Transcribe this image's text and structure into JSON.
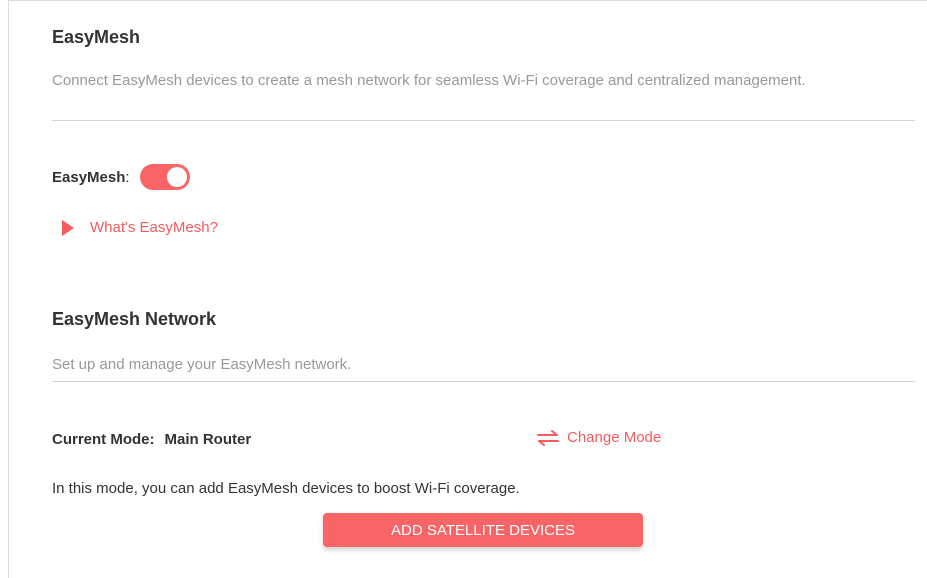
{
  "easymesh": {
    "title": "EasyMesh",
    "description": "Connect EasyMesh devices to create a mesh network for seamless Wi-Fi coverage and centralized management.",
    "toggle_label": "EasyMesh",
    "toggle_colon": ":",
    "toggle_on": true,
    "help_link": "What's EasyMesh?"
  },
  "network": {
    "title": "EasyMesh Network",
    "description": "Set up and manage your EasyMesh network.",
    "current_mode_label": "Current Mode:",
    "current_mode_value": "Main Router",
    "change_mode_label": "Change Mode",
    "mode_info": "In this mode, you can add EasyMesh devices to boost Wi-Fi coverage.",
    "add_button_label": "ADD SATELLITE DEVICES"
  },
  "icons": {
    "expand": "triangle-right-icon",
    "change_mode": "swap-arrows-icon"
  },
  "colors": {
    "accent": "#f96567",
    "link": "#f75b5e",
    "title": "#333333",
    "description": "#999999"
  }
}
